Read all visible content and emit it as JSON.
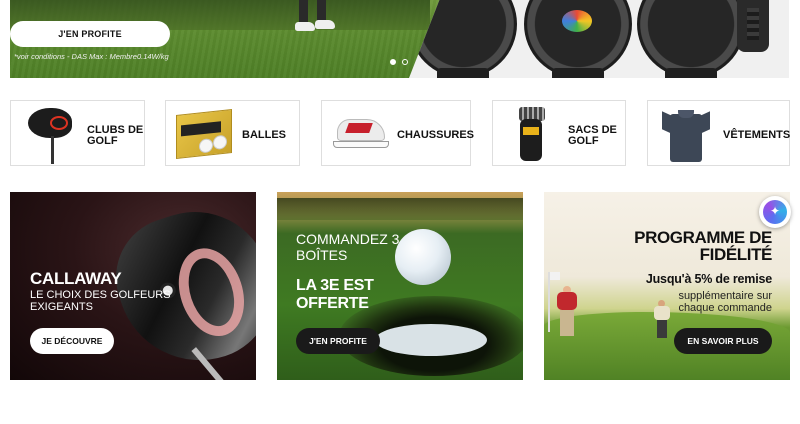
{
  "hero": {
    "cta_label": "J'EN PROFITE",
    "legal_text": "*voir conditions - DAS Max : Membre0.14W/kg",
    "carousel": {
      "slides": 2,
      "active": 1
    }
  },
  "categories": [
    {
      "label": "CLUBS DE GOLF",
      "icon": "golf-driver-icon"
    },
    {
      "label": "BALLES",
      "icon": "golf-balls-box-icon"
    },
    {
      "label": "CHAUSSURES",
      "icon": "golf-shoe-icon"
    },
    {
      "label": "SACS DE GOLF",
      "icon": "golf-bag-icon"
    },
    {
      "label": "VÊTEMENTS",
      "icon": "polo-shirt-icon"
    }
  ],
  "promos": [
    {
      "title": "CALLAWAY",
      "subtitle": "LE CHOIX DES GOLFEURS EXIGEANTS",
      "cta_label": "JE DÉCOUVRE"
    },
    {
      "title": "COMMANDEZ 3 BOÎTES",
      "subtitle": "LA 3E EST OFFERTE",
      "cta_label": "J'EN PROFITE"
    },
    {
      "title": "PROGRAMME DE FIDÉLITÉ",
      "subtitle": "Jusqu'à 5% de remise",
      "detail": "supplémentaire sur chaque commande",
      "cta_label": "EN SAVOIR PLUS"
    }
  ],
  "colors": {
    "cta_dark": "#1a1a1a",
    "cta_light": "#ffffff",
    "card_border": "#dedede"
  },
  "assistant": {
    "icon": "ai-assistant-icon"
  }
}
